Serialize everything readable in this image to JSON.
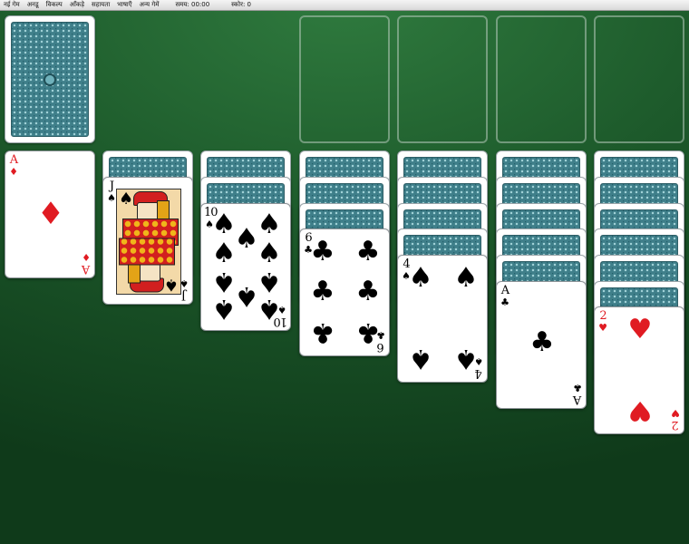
{
  "menu": {
    "items": [
      "नई गेम",
      "अनडू",
      "विकल्प",
      "आँकड़े",
      "सहायता",
      "भाषाएँ",
      "अन्य गेमें"
    ],
    "time_label": "समय: 00:00",
    "score_label": "स्कोर: 0"
  },
  "colors": {
    "felt": "#1d5a2b",
    "red_suit": "#e01b22",
    "card_back": "#3f7f8a"
  },
  "stock": {
    "card": "card-back"
  },
  "waste": {
    "rank": "A",
    "suit": "♦"
  },
  "tableau": [
    {
      "face_down": 0,
      "rank": "A",
      "suit": "♦"
    },
    {
      "face_down": 1,
      "rank": "J",
      "suit": "♠"
    },
    {
      "face_down": 2,
      "rank": "10",
      "suit": "♠"
    },
    {
      "face_down": 3,
      "rank": "6",
      "suit": "♣"
    },
    {
      "face_down": 4,
      "rank": "4",
      "suit": "♠"
    },
    {
      "face_down": 5,
      "rank": "A",
      "suit": "♣"
    },
    {
      "face_down": 6,
      "rank": "2",
      "suit": "♥"
    }
  ],
  "foundations": 4
}
